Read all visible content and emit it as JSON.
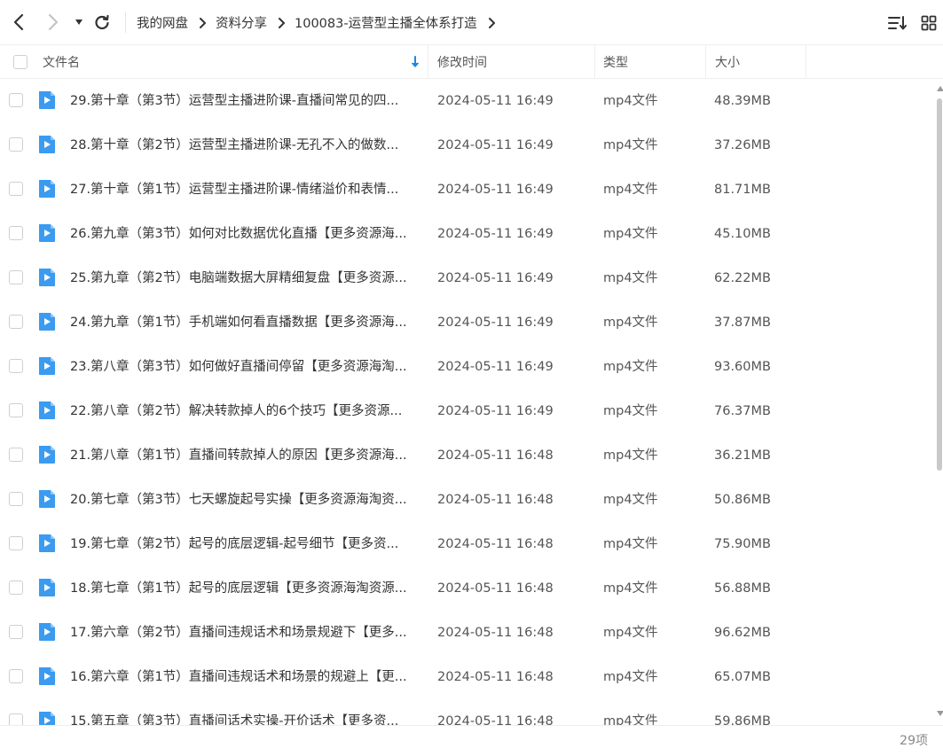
{
  "nav": {
    "back_icon": "chevron-left-icon",
    "forward_icon": "chevron-right-icon",
    "history_icon": "caret-down-icon",
    "refresh_icon": "refresh-icon"
  },
  "breadcrumb": [
    "我的网盘",
    "资料分享",
    "100083-运营型主播全体系打造"
  ],
  "toolbar_right": {
    "sort_icon": "sort-list-icon",
    "view_icon": "grid-view-icon"
  },
  "columns": {
    "name": "文件名",
    "modified": "修改时间",
    "type": "类型",
    "size": "大小"
  },
  "colors": {
    "accent": "#1e88e5",
    "file_icon": "#3a9bf0"
  },
  "files": [
    {
      "name": "29.第十章（第3节）运营型主播进阶课-直播间常见的四...",
      "modified": "2024-05-11 16:49",
      "type": "mp4文件",
      "size": "48.39MB"
    },
    {
      "name": "28.第十章（第2节）运营型主播进阶课-无孔不入的做数...",
      "modified": "2024-05-11 16:49",
      "type": "mp4文件",
      "size": "37.26MB"
    },
    {
      "name": "27.第十章（第1节）运营型主播进阶课-情绪溢价和表情...",
      "modified": "2024-05-11 16:49",
      "type": "mp4文件",
      "size": "81.71MB"
    },
    {
      "name": "26.第九章（第3节）如何对比数据优化直播【更多资源海...",
      "modified": "2024-05-11 16:49",
      "type": "mp4文件",
      "size": "45.10MB"
    },
    {
      "name": "25.第九章（第2节）电脑端数据大屏精细复盘【更多资源...",
      "modified": "2024-05-11 16:49",
      "type": "mp4文件",
      "size": "62.22MB"
    },
    {
      "name": "24.第九章（第1节）手机端如何看直播数据【更多资源海...",
      "modified": "2024-05-11 16:49",
      "type": "mp4文件",
      "size": "37.87MB"
    },
    {
      "name": "23.第八章（第3节）如何做好直播间停留【更多资源海淘...",
      "modified": "2024-05-11 16:49",
      "type": "mp4文件",
      "size": "93.60MB"
    },
    {
      "name": "22.第八章（第2节）解决转款掉人的6个技巧【更多资源...",
      "modified": "2024-05-11 16:49",
      "type": "mp4文件",
      "size": "76.37MB"
    },
    {
      "name": "21.第八章（第1节）直播间转款掉人的原因【更多资源海...",
      "modified": "2024-05-11 16:48",
      "type": "mp4文件",
      "size": "36.21MB"
    },
    {
      "name": "20.第七章（第3节）七天螺旋起号实操【更多资源海淘资...",
      "modified": "2024-05-11 16:48",
      "type": "mp4文件",
      "size": "50.86MB"
    },
    {
      "name": "19.第七章（第2节）起号的底层逻辑-起号细节【更多资...",
      "modified": "2024-05-11 16:48",
      "type": "mp4文件",
      "size": "75.90MB"
    },
    {
      "name": "18.第七章（第1节）起号的底层逻辑【更多资源海淘资源...",
      "modified": "2024-05-11 16:48",
      "type": "mp4文件",
      "size": "56.88MB"
    },
    {
      "name": "17.第六章（第2节）直播间违规话术和场景规避下【更多...",
      "modified": "2024-05-11 16:48",
      "type": "mp4文件",
      "size": "96.62MB"
    },
    {
      "name": "16.第六章（第1节）直播间违规话术和场景的规避上【更...",
      "modified": "2024-05-11 16:48",
      "type": "mp4文件",
      "size": "65.07MB"
    },
    {
      "name": "15.第五章（第3节）直播间话术实操-开价话术【更多资...",
      "modified": "2024-05-11 16:48",
      "type": "mp4文件",
      "size": "59.86MB"
    }
  ],
  "footer": {
    "count": "29项"
  }
}
